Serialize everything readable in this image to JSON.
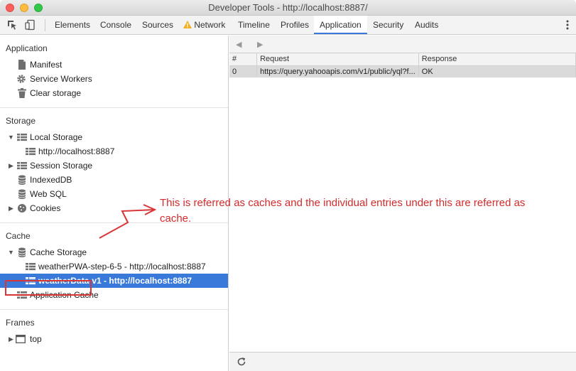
{
  "window": {
    "title": "Developer Tools - http://localhost:8887/"
  },
  "tabs": [
    {
      "label": "Elements"
    },
    {
      "label": "Console"
    },
    {
      "label": "Sources"
    },
    {
      "label": "Network",
      "warning": true
    },
    {
      "label": "Timeline"
    },
    {
      "label": "Profiles"
    },
    {
      "label": "Application",
      "active": true
    },
    {
      "label": "Security"
    },
    {
      "label": "Audits"
    }
  ],
  "sidebar": {
    "application": {
      "title": "Application",
      "items": [
        {
          "label": "Manifest",
          "icon": "document-icon"
        },
        {
          "label": "Service Workers",
          "icon": "gear-icon"
        },
        {
          "label": "Clear storage",
          "icon": "trash-icon"
        }
      ]
    },
    "storage": {
      "title": "Storage",
      "items": [
        {
          "label": "Local Storage",
          "icon": "grid-icon"
        },
        {
          "label": "http://localhost:8887",
          "icon": "grid-icon"
        },
        {
          "label": "Session Storage",
          "icon": "grid-icon"
        },
        {
          "label": "IndexedDB",
          "icon": "database-icon"
        },
        {
          "label": "Web SQL",
          "icon": "database-icon"
        },
        {
          "label": "Cookies",
          "icon": "cookie-icon"
        }
      ]
    },
    "cache": {
      "title": "Cache",
      "items": [
        {
          "label": "Cache Storage",
          "icon": "database-icon"
        },
        {
          "label": "weatherPWA-step-6-5 - http://localhost:8887",
          "icon": "grid-icon"
        },
        {
          "label": "weatherData-v1 - http://localhost:8887",
          "icon": "grid-icon",
          "selected": true
        },
        {
          "label": "Application Cache",
          "icon": "grid-icon"
        }
      ]
    },
    "frames": {
      "title": "Frames",
      "items": [
        {
          "label": "top",
          "icon": "frame-icon"
        }
      ]
    }
  },
  "table": {
    "columns": [
      "#",
      "Request",
      "Response"
    ],
    "rows": [
      [
        "0",
        "https://query.yahooapis.com/v1/public/yql?f...",
        "OK"
      ]
    ]
  },
  "annotation": {
    "text": "This is referred as caches and the individual entries under this are referred as cache.",
    "color": "#d32b2b"
  },
  "colors": {
    "selection": "#3879d9",
    "annotation_red": "#d83535"
  }
}
